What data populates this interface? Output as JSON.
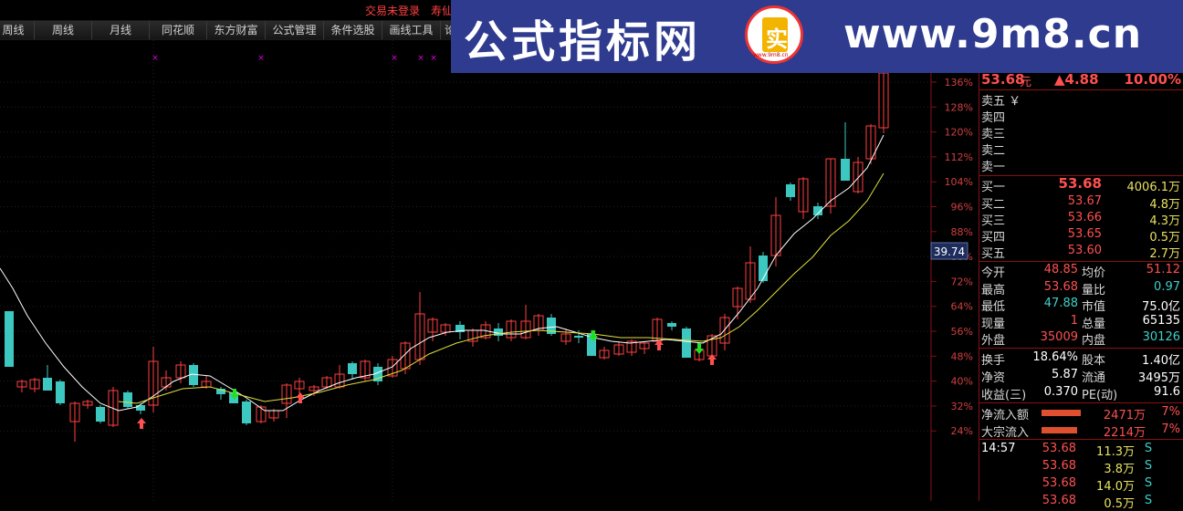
{
  "app": {
    "login_status": "交易未登录",
    "extra": "寿仙"
  },
  "toolbar": {
    "items": [
      {
        "label": "周线",
        "id": "daily"
      },
      {
        "label": "周线",
        "id": "weekly"
      },
      {
        "label": "月线",
        "id": "monthly"
      },
      {
        "label": "同花顺",
        "id": "ths"
      },
      {
        "label": "东方财富",
        "id": "eastmoney"
      },
      {
        "label": "公式管理",
        "id": "formula"
      },
      {
        "label": "条件选股",
        "id": "screen"
      },
      {
        "label": "画线工具",
        "id": "draw"
      },
      {
        "label": "论",
        "id": "forum"
      }
    ]
  },
  "banner": {
    "title": "公式指标网",
    "url": "www.9m8.cn",
    "logo_glyph": "实",
    "logo_small": "www.9m8.cn"
  },
  "chart": {
    "y_axis_labels": [
      "136%",
      "128%",
      "120%",
      "112%",
      "104%",
      "96%",
      "88%",
      "80%",
      "72%",
      "64%",
      "56%",
      "48%",
      "40%",
      "32%",
      "24%"
    ],
    "crosshair_value": "39.74",
    "colors": {
      "up": "#ff4040",
      "down": "#3cc8c0",
      "ma_short": "#ffffff",
      "ma_long": "#e0e040",
      "arrow_up": "#ff5050",
      "arrow_down": "#20e020",
      "marker": "#e000e0"
    }
  },
  "quote": {
    "price": "53.68",
    "price_unit": "元",
    "change": "▲4.88",
    "change_pct": "10.00%",
    "sell_header": "卖五 ￥",
    "sells": [
      {
        "label": "卖四"
      },
      {
        "label": "卖三"
      },
      {
        "label": "卖二"
      },
      {
        "label": "卖一"
      }
    ],
    "buys": [
      {
        "label": "买一",
        "price": "53.68",
        "vol": "4006.1万"
      },
      {
        "label": "买二",
        "price": "53.67",
        "vol": "4.8万"
      },
      {
        "label": "买三",
        "price": "53.66",
        "vol": "4.3万"
      },
      {
        "label": "买四",
        "price": "53.65",
        "vol": "0.5万"
      },
      {
        "label": "买五",
        "price": "53.60",
        "vol": "2.7万"
      }
    ],
    "stats": [
      {
        "l1": "今开",
        "v1": "48.85",
        "c1": "red",
        "l2": "均价",
        "v2": "51.12",
        "c2": "red"
      },
      {
        "l1": "最高",
        "v1": "53.68",
        "c1": "red",
        "l2": "量比",
        "v2": "0.97",
        "c2": "green"
      },
      {
        "l1": "最低",
        "v1": "47.88",
        "c1": "green",
        "l2": "市值",
        "v2": "75.0亿",
        "c2": "white"
      },
      {
        "l1": "现量",
        "v1": "1",
        "c1": "red",
        "l2": "总量",
        "v2": "65135",
        "c2": "white"
      },
      {
        "l1": "外盘",
        "v1": "35009",
        "c1": "red",
        "l2": "内盘",
        "v2": "30126",
        "c2": "green"
      }
    ],
    "stats2": [
      {
        "l1": "换手",
        "v1": "18.64%",
        "l2": "股本",
        "v2": "1.40亿"
      },
      {
        "l1": "净资",
        "v1": "5.87",
        "l2": "流通",
        "v2": "3495万"
      },
      {
        "l1": "收益(三)",
        "v1": "0.370",
        "l2": "PE(动)",
        "v2": "91.6"
      }
    ],
    "flows": [
      {
        "label": "净流入额",
        "value": "2471万",
        "pct": "7%",
        "bar": 0.7
      },
      {
        "label": "大宗流入",
        "value": "2214万",
        "pct": "7%",
        "bar": 0.63
      }
    ],
    "ticks": [
      {
        "time": "14:57",
        "price": "53.68",
        "vol": "11.3万",
        "side": "S"
      },
      {
        "time": "",
        "price": "53.68",
        "vol": "3.8万",
        "side": "S"
      },
      {
        "time": "",
        "price": "53.68",
        "vol": "14.0万",
        "side": "S"
      },
      {
        "time": "",
        "price": "53.68",
        "vol": "0.5万",
        "side": "S"
      }
    ]
  }
}
